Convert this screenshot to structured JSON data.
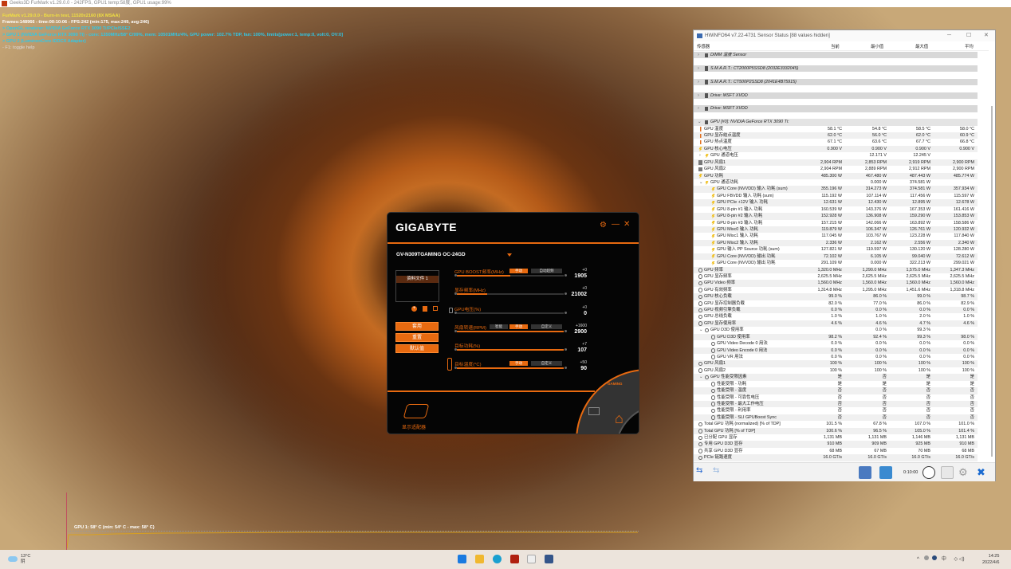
{
  "furmark": {
    "window_title": "Geeks3D FurMark v1.29.0.0 - 242FPS, GPU1 temp:58度, GPU1 usage:99%",
    "osd": [
      "FurMark v1.29.0.0 - Burn-in test, 11520x2160 (8X MSAA)",
      "Frames:148966 - time:00:10:06 - FPS:242 (min:175, max:249, avg:246)",
      "> OpenGL renderer: NVIDIA GeForce RTX 3090 Ti/PCIe/SSE2",
      "> GPU 1 (NVIDIA GeForce RTX 3090 Ti) - core: 1350MHz/58° C/99%, mem: 10501MHz/4%, GPU power: 102.7% TDP, fan: 100%, limits[power:1, temp:0, volt:0, OV:0]",
      "> GPU 2 (LuminonCore IDDCX Adapter)",
      "- F1: toggle help"
    ],
    "graph_label": "GPU 1: 58° C (min: 54° C - max: 58° C)"
  },
  "hwinfo": {
    "title": "HWiNFO64 v7.22-4731 Sensor Status [88 values hidden]",
    "columns": [
      "传感器",
      "当前",
      "最小值",
      "最大值",
      "平均"
    ],
    "rows": [
      {
        "kind": "group",
        "label": "DIMM 温度 Sensor"
      },
      {
        "kind": "group",
        "label": "S.M.A.R.T.: CT2000P5SSD8 (2032E3332045)"
      },
      {
        "kind": "group",
        "label": "S.M.A.R.T.: CT500P2SSD8 (2041E4B75915)"
      },
      {
        "kind": "group",
        "label": "Drive: MSFT XVDD"
      },
      {
        "kind": "group",
        "label": "Drive: MSFT XVDD"
      },
      {
        "kind": "group-open",
        "label": "GPU [#0]: NVIDIA GeForce RTX 3090 Ti:"
      },
      {
        "level": 0,
        "icon": "therm",
        "label": "GPU 温度",
        "cur": "58.1 °C",
        "min": "54.8 °C",
        "max": "58.5 °C",
        "avg": "58.0 °C"
      },
      {
        "level": 0,
        "icon": "therm",
        "label": "GPU 显存结点温度",
        "cur": "62.0 °C",
        "min": "56.0 °C",
        "max": "62.0 °C",
        "avg": "60.9 °C"
      },
      {
        "level": 0,
        "icon": "therm",
        "label": "GPU 热点温度",
        "cur": "67.1 °C",
        "min": "63.6 °C",
        "max": "67.7 °C",
        "avg": "66.8 °C"
      },
      {
        "level": 0,
        "icon": "volt",
        "label": "GPU 核心电压",
        "cur": "0.900 V",
        "min": "0.900 V",
        "max": "0.900 V",
        "avg": "0.900 V"
      },
      {
        "level": 1,
        "icon": "volt",
        "chev": ">",
        "label": "GPU 通道电压",
        "cur": "",
        "min": "12.171 V",
        "max": "12.245 V",
        "avg": ""
      },
      {
        "level": 0,
        "icon": "fan",
        "label": "GPU 风扇1",
        "cur": "2,904 RPM",
        "min": "2,853 RPM",
        "max": "2,919 RPM",
        "avg": "2,900 RPM"
      },
      {
        "level": 0,
        "icon": "fan",
        "label": "GPU 风扇2",
        "cur": "2,904 RPM",
        "min": "2,889 RPM",
        "max": "2,912 RPM",
        "avg": "2,900 RPM"
      },
      {
        "level": 0,
        "icon": "volt",
        "label": "GPU 功耗",
        "cur": "485.300 W",
        "min": "467.480 W",
        "max": "487.443 W",
        "avg": "485.774 W"
      },
      {
        "level": 1,
        "icon": "volt",
        "chev": "v",
        "label": "GPU 通道功耗",
        "cur": "",
        "min": "0.000 W",
        "max": "374.581 W",
        "avg": ""
      },
      {
        "level": 2,
        "icon": "volt",
        "label": "GPU Core (NVVDD) 输入 功耗 (sum)",
        "cur": "355.196 W",
        "min": "314.273 W",
        "max": "374.581 W",
        "avg": "357.934 W"
      },
      {
        "level": 2,
        "icon": "volt",
        "label": "GPU FBVDD 输入 功耗 (sum)",
        "cur": "115.192 W",
        "min": "107.114 W",
        "max": "117.456 W",
        "avg": "115.597 W"
      },
      {
        "level": 2,
        "icon": "volt",
        "label": "GPU PCIe +12V 输入 功耗",
        "cur": "12.631 W",
        "min": "12.430 W",
        "max": "12.895 W",
        "avg": "12.678 W"
      },
      {
        "level": 2,
        "icon": "volt",
        "label": "GPU 8-pin #1 输入 功耗",
        "cur": "160.539 W",
        "min": "143.376 W",
        "max": "167.353 W",
        "avg": "161.416 W"
      },
      {
        "level": 2,
        "icon": "volt",
        "label": "GPU 8-pin #2 输入 功耗",
        "cur": "152.928 W",
        "min": "136.908 W",
        "max": "159.290 W",
        "avg": "153.853 W"
      },
      {
        "level": 2,
        "icon": "volt",
        "label": "GPU 8-pin #3 输入 功耗",
        "cur": "157.215 W",
        "min": "142.066 W",
        "max": "163.892 W",
        "avg": "158.586 W"
      },
      {
        "level": 2,
        "icon": "volt",
        "label": "GPU Misc0 输入 功耗",
        "cur": "119.879 W",
        "min": "106.347 W",
        "max": "126.761 W",
        "avg": "120.932 W"
      },
      {
        "level": 2,
        "icon": "volt",
        "label": "GPU Misc1 输入 功耗",
        "cur": "117.045 W",
        "min": "103.767 W",
        "max": "123.228 W",
        "avg": "117.840 W"
      },
      {
        "level": 2,
        "icon": "volt",
        "label": "GPU Misc2 输入 功耗",
        "cur": "2.336 W",
        "min": "2.162 W",
        "max": "2.556 W",
        "avg": "2.340 W"
      },
      {
        "level": 2,
        "icon": "volt",
        "label": "GPU 输入 PP Source 功耗 (sum)",
        "cur": "127.821 W",
        "min": "119.597 W",
        "max": "130.120 W",
        "avg": "128.280 W"
      },
      {
        "level": 2,
        "icon": "volt",
        "label": "GPU Core (NVVDD) 输出 功耗",
        "cur": "72.102 W",
        "min": "6.105 W",
        "max": "99.040 W",
        "avg": "72.612 W"
      },
      {
        "level": 2,
        "icon": "volt",
        "label": "GPU Core (NVVDD) 输出 功耗",
        "cur": "291.109 W",
        "min": "0.000 W",
        "max": "322.213 W",
        "avg": "299.021 W"
      },
      {
        "level": 0,
        "icon": "clock",
        "label": "GPU 频率",
        "cur": "1,320.0 MHz",
        "min": "1,290.0 MHz",
        "max": "1,575.0 MHz",
        "avg": "1,347.3 MHz"
      },
      {
        "level": 0,
        "icon": "clock",
        "label": "GPU 显存频率",
        "cur": "2,625.5 MHz",
        "min": "2,625.5 MHz",
        "max": "2,625.5 MHz",
        "avg": "2,625.5 MHz"
      },
      {
        "level": 0,
        "icon": "clock",
        "label": "GPU Video 频率",
        "cur": "1,560.0 MHz",
        "min": "1,560.0 MHz",
        "max": "1,560.0 MHz",
        "avg": "1,560.0 MHz"
      },
      {
        "level": 0,
        "icon": "clock",
        "label": "GPU 有效频率",
        "cur": "1,314.8 MHz",
        "min": "1,295.0 MHz",
        "max": "1,451.6 MHz",
        "avg": "1,318.8 MHz"
      },
      {
        "level": 0,
        "icon": "usage",
        "label": "GPU 核心负载",
        "cur": "99.0 %",
        "min": "86.0 %",
        "max": "99.0 %",
        "avg": "98.7 %"
      },
      {
        "level": 0,
        "icon": "usage",
        "label": "GPU 显存控制器负载",
        "cur": "82.0 %",
        "min": "77.0 %",
        "max": "86.0 %",
        "avg": "82.9 %"
      },
      {
        "level": 0,
        "icon": "usage",
        "label": "GPU 视频引擎负载",
        "cur": "0.0 %",
        "min": "0.0 %",
        "max": "0.0 %",
        "avg": "0.0 %"
      },
      {
        "level": 0,
        "icon": "usage",
        "label": "GPU 总线负载",
        "cur": "1.0 %",
        "min": "1.0 %",
        "max": "2.0 %",
        "avg": "1.0 %"
      },
      {
        "level": 0,
        "icon": "usage",
        "label": "GPU 显存使用率",
        "cur": "4.6 %",
        "min": "4.6 %",
        "max": "4.7 %",
        "avg": "4.6 %"
      },
      {
        "level": 1,
        "icon": "usage",
        "chev": "v",
        "label": "GPU D3D 使用率",
        "cur": "",
        "min": "0.0 %",
        "max": "99.3 %",
        "avg": ""
      },
      {
        "level": 2,
        "icon": "usage",
        "label": "GPU D3D 使用率",
        "cur": "98.2 %",
        "min": "92.4 %",
        "max": "99.3 %",
        "avg": "98.0 %"
      },
      {
        "level": 2,
        "icon": "usage",
        "label": "GPU Video Decode 0 用法",
        "cur": "0.0 %",
        "min": "0.0 %",
        "max": "0.0 %",
        "avg": "0.0 %"
      },
      {
        "level": 2,
        "icon": "usage",
        "label": "GPU Video Encode 0 用法",
        "cur": "0.0 %",
        "min": "0.0 %",
        "max": "0.0 %",
        "avg": "0.0 %"
      },
      {
        "level": 2,
        "icon": "usage",
        "label": "GPU VR 用法",
        "cur": "0.0 %",
        "min": "0.0 %",
        "max": "0.0 %",
        "avg": "0.0 %"
      },
      {
        "level": 0,
        "icon": "usage",
        "label": "GPU 风扇1",
        "cur": "100 %",
        "min": "100 %",
        "max": "100 %",
        "avg": "100 %"
      },
      {
        "level": 0,
        "icon": "usage",
        "label": "GPU 风扇2",
        "cur": "100 %",
        "min": "100 %",
        "max": "100 %",
        "avg": "100 %"
      },
      {
        "level": 1,
        "icon": "usage",
        "chev": "v",
        "label": "GPU 性能受限因素",
        "cur": "是",
        "min": "否",
        "max": "是",
        "avg": "是"
      },
      {
        "level": 2,
        "icon": "usage",
        "label": "性能受限 - 功耗",
        "cur": "是",
        "min": "是",
        "max": "是",
        "avg": "是"
      },
      {
        "level": 2,
        "icon": "usage",
        "label": "性能受限 - 温度",
        "cur": "否",
        "min": "否",
        "max": "否",
        "avg": "否"
      },
      {
        "level": 2,
        "icon": "usage",
        "label": "性能受限 - 可靠性电压",
        "cur": "否",
        "min": "否",
        "max": "否",
        "avg": "否"
      },
      {
        "level": 2,
        "icon": "usage",
        "label": "性能受限 - 最大工作电压",
        "cur": "否",
        "min": "否",
        "max": "否",
        "avg": "否"
      },
      {
        "level": 2,
        "icon": "usage",
        "label": "性能受限 - 利用率",
        "cur": "否",
        "min": "否",
        "max": "否",
        "avg": "否"
      },
      {
        "level": 2,
        "icon": "usage",
        "label": "性能受限 - SLI GPUBoost Sync",
        "cur": "否",
        "min": "否",
        "max": "否",
        "avg": "否"
      },
      {
        "level": 0,
        "icon": "usage",
        "label": "Total GPU 功耗 (normalized) [% of TDP]",
        "cur": "101.5 %",
        "min": "67.8 %",
        "max": "107.0 %",
        "avg": "101.0 %"
      },
      {
        "level": 0,
        "icon": "usage",
        "label": "Total GPU 功耗 [% of TDP]",
        "cur": "100.6 %",
        "min": "96.5 %",
        "max": "105.0 %",
        "avg": "101.4 %"
      },
      {
        "level": 0,
        "icon": "usage",
        "label": "已分配 GPU 显存",
        "cur": "1,131 MB",
        "min": "1,131 MB",
        "max": "1,146 MB",
        "avg": "1,131 MB"
      },
      {
        "level": 0,
        "icon": "usage",
        "label": "专用 GPU D3D 显存",
        "cur": "910 MB",
        "min": "909 MB",
        "max": "925 MB",
        "avg": "910 MB"
      },
      {
        "level": 0,
        "icon": "usage",
        "label": "共享 GPU D3D 显存",
        "cur": "68 MB",
        "min": "67 MB",
        "max": "70 MB",
        "avg": "68 MB"
      },
      {
        "level": 0,
        "icon": "usage",
        "label": "PCIe 链路速度",
        "cur": "16.0 GT/s",
        "min": "16.0 GT/s",
        "max": "16.0 GT/s",
        "avg": "16.0 GT/s"
      }
    ],
    "timer": "0:10:00"
  },
  "gigabyte": {
    "logo": "GIGABYTE",
    "model": "GV-N309TGAMING OC-24GD",
    "profile_tab": "资料文件 1",
    "buttons": {
      "apply": "套用",
      "reset": "重置",
      "default": "默认值"
    },
    "sliders": [
      {
        "label": "GPU BOOST频率(MHz)",
        "delta": "+0",
        "value": "1905",
        "fill": 0.5,
        "tabs": [
          "手动",
          "自动超频"
        ],
        "active": 0
      },
      {
        "label": "显存频率(MHz)",
        "delta": "+0",
        "value": "21002",
        "fill": 0.28
      },
      {
        "label": "GPU电压(%)",
        "delta": "+0",
        "value": "0",
        "fill": 0.0
      },
      {
        "label": "风扇转速(RPM)",
        "delta": "+1600",
        "value": "2900",
        "fill": 1.0,
        "tabs": [
          "智能",
          "手动",
          "自定义"
        ],
        "active": 1
      },
      {
        "label": "目标功耗(%)",
        "delta": "+7",
        "value": "107",
        "fill": 1.0
      },
      {
        "label": "目标温度(°C)",
        "delta": "+50",
        "value": "90",
        "fill": 1.0,
        "tabs": [
          "手动",
          "自定义"
        ],
        "active": 0
      }
    ],
    "card_label": "显示适配器",
    "brand_badge": "GAMING"
  },
  "taskbar": {
    "weather_temp": "13°C",
    "weather_desc": "阴",
    "ime": "中",
    "time": "14:25",
    "date": "2022/4/6"
  },
  "colors": {
    "accent": "#e86a10",
    "hw_group": "#d8d8d8"
  }
}
